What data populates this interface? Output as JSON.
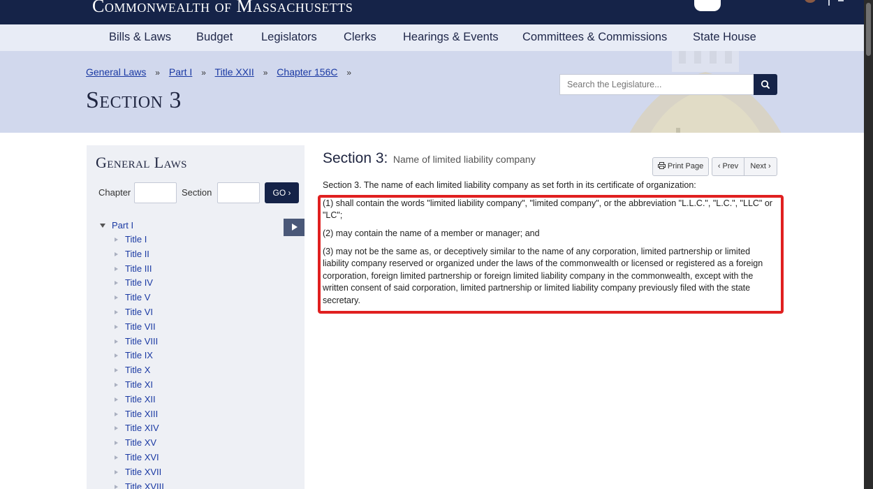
{
  "header": {
    "brand": "Commonwealth of Massachusetts"
  },
  "nav": {
    "items": [
      "Bills & Laws",
      "Budget",
      "Legislators",
      "Clerks",
      "Hearings & Events",
      "Committees & Commissions",
      "State House"
    ]
  },
  "breadcrumb": [
    "General Laws",
    "Part I",
    "Title XXII",
    "Chapter 156C"
  ],
  "breadcrumb_separator": "»",
  "page_title": "Section 3",
  "search": {
    "placeholder": "Search the Legislature..."
  },
  "sidebar": {
    "title": "General Laws",
    "chapter_label": "Chapter",
    "section_label": "Section",
    "go_label": "GO ›",
    "part": "Part I",
    "titles": [
      "Title I",
      "Title II",
      "Title III",
      "Title IV",
      "Title V",
      "Title VI",
      "Title VII",
      "Title VIII",
      "Title IX",
      "Title X",
      "Title XI",
      "Title XII",
      "Title XIII",
      "Title XIV",
      "Title XV",
      "Title XVI",
      "Title XVII",
      "Title XVIII"
    ]
  },
  "main": {
    "section_number": "Section 3:",
    "section_name": "Name of limited liability company",
    "print_label": "Print Page",
    "prev_label": "‹ Prev",
    "next_label": "Next ›",
    "intro": "Section 3. The name of each limited liability company as set forth in its certificate of organization:",
    "paragraphs": [
      "(1) shall contain the words \"limited liability company\", \"limited company\", or the abbreviation \"L.L.C.\", \"L.C.\", \"LLC\" or \"LC\";",
      "(2) may contain the name of a member or manager; and",
      "(3) may not be the same as, or deceptively similar to the name of any corporation, limited partnership or limited liability company reserved or organized under the laws of the commonwealth or licensed or registered as a foreign corporation, foreign limited partnership or foreign limited liability company in the commonwealth, except with the written consent of said corporation, limited partnership or limited liability company previously filed with the state secretary."
    ]
  },
  "colors": {
    "header_bg": "#152348",
    "nav_bg": "#e8ecf6",
    "hero_bg": "#d1d8ed",
    "link": "#1a39a3",
    "highlight": "#e02020"
  },
  "icons": {
    "search": "search-icon",
    "print": "print-icon",
    "toggle": "play-arrow-icon"
  }
}
